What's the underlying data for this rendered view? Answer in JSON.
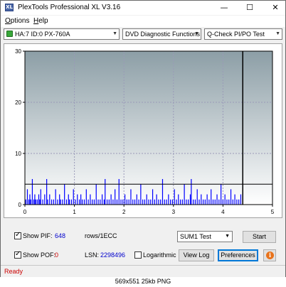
{
  "window": {
    "title": "PlexTools Professional XL V3.16",
    "icon_text": "XL",
    "minimize_glyph": "—",
    "maximize_glyph": "☐",
    "close_glyph": "✕"
  },
  "menu": {
    "items": [
      "Options",
      "Help"
    ]
  },
  "toolbar": {
    "drive": "HA:7 ID:0  PX-760A",
    "function": "DVD Diagnostic Functions",
    "test": "Q-Check PI/PO Test",
    "arrow": "▼"
  },
  "chart_data": {
    "type": "bar",
    "title": "",
    "xlabel": "",
    "ylabel": "",
    "xlim": [
      0,
      5
    ],
    "ylim": [
      0,
      30
    ],
    "x_ticks": [
      0,
      1,
      2,
      3,
      4,
      5
    ],
    "y_ticks": [
      0,
      10,
      20,
      30
    ],
    "threshold": 4,
    "scan_end_x": 4.4,
    "grid": true,
    "colors": {
      "bar": "#0000ff",
      "plot_top": "#8c9ea6",
      "plot_bottom": "#ffffff",
      "grid": "#9a9ab8",
      "threshold": "#000000"
    },
    "series": [
      {
        "x": [
          0.02,
          0.05,
          0.08,
          0.1,
          0.12,
          0.15,
          0.18,
          0.2,
          0.22,
          0.25,
          0.28,
          0.3,
          0.32,
          0.36,
          0.4,
          0.44,
          0.46,
          0.5,
          0.54,
          0.58,
          0.62,
          0.66,
          0.7,
          0.72,
          0.76,
          0.8,
          0.84,
          0.88,
          0.9,
          0.94,
          0.98,
          1.02,
          1.06,
          1.1,
          1.13,
          1.16,
          1.2,
          1.24,
          1.28,
          1.32,
          1.36,
          1.4,
          1.44,
          1.48,
          1.52,
          1.56,
          1.6,
          1.62,
          1.66,
          1.7,
          1.74,
          1.78,
          1.82,
          1.86,
          1.9,
          1.94,
          1.98,
          2.02,
          2.06,
          2.1,
          2.14,
          2.18,
          2.22,
          2.26,
          2.3,
          2.34,
          2.38,
          2.42,
          2.46,
          2.5,
          2.54,
          2.58,
          2.62,
          2.66,
          2.7,
          2.74,
          2.78,
          2.82,
          2.86,
          2.9,
          2.94,
          2.98,
          3.02,
          3.06,
          3.1,
          3.14,
          3.18,
          3.22,
          3.26,
          3.3,
          3.34,
          3.36,
          3.4,
          3.44,
          3.48,
          3.52,
          3.56,
          3.6,
          3.64,
          3.68,
          3.72,
          3.76,
          3.8,
          3.84,
          3.88,
          3.92,
          3.96,
          4.0,
          4.04,
          4.08,
          4.12,
          4.16,
          4.2,
          4.24,
          4.28,
          4.32,
          4.36
        ],
        "values": [
          1,
          3,
          1,
          2,
          1,
          5,
          1,
          2,
          1,
          1,
          2,
          1,
          3,
          1,
          2,
          5,
          1,
          2,
          1,
          1,
          3,
          1,
          2,
          1,
          1,
          4,
          1,
          2,
          1,
          1,
          3,
          1,
          2,
          1,
          2,
          1,
          1,
          3,
          1,
          2,
          1,
          1,
          4,
          1,
          1,
          2,
          1,
          5,
          1,
          1,
          2,
          1,
          3,
          1,
          5,
          1,
          1,
          2,
          1,
          1,
          3,
          1,
          1,
          2,
          1,
          4,
          1,
          1,
          2,
          1,
          1,
          3,
          1,
          2,
          1,
          1,
          5,
          1,
          1,
          2,
          1,
          1,
          3,
          1,
          2,
          1,
          1,
          4,
          1,
          1,
          2,
          5,
          1,
          1,
          3,
          1,
          2,
          1,
          1,
          2,
          1,
          3,
          1,
          1,
          2,
          1,
          4,
          1,
          2,
          1,
          1,
          3,
          1,
          2,
          1,
          1,
          2
        ]
      }
    ]
  },
  "controls": {
    "show_pif_label": "Show PIF:",
    "pif_value": "648",
    "rows_label": "rows/1ECC",
    "show_pof_label": "Show POF:",
    "pof_value": "0",
    "lsn_label": "LSN:",
    "lsn_value": "2298496",
    "logarithmic_label": "Logarithmic",
    "sum_select": "SUM1 Test",
    "start_button": "Start",
    "view_log_button": "View Log",
    "preferences_button": "Preferences",
    "info_icon_glyph": "i"
  },
  "status": {
    "text": "Ready"
  },
  "caption": {
    "text": "569x551  25kb  PNG"
  }
}
